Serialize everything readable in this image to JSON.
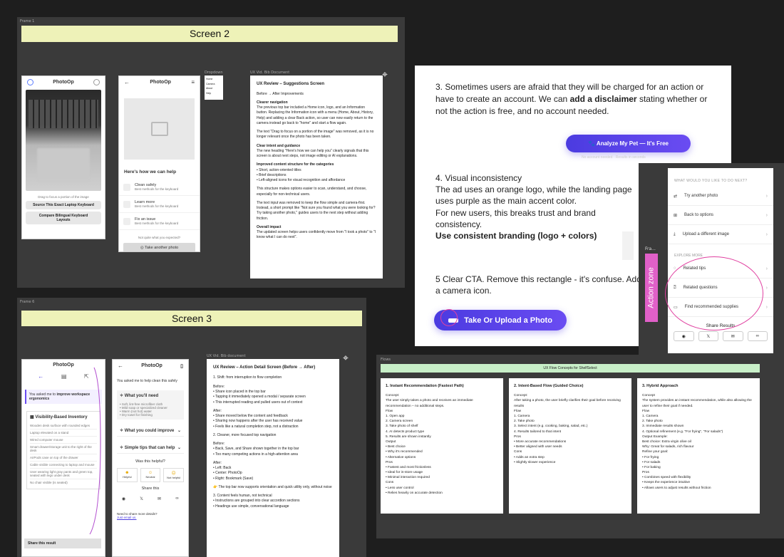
{
  "frames": {
    "frame1_label": "Frame 1",
    "frame2_label": "Frame 6",
    "frame3_label": "Frame"
  },
  "screen2": {
    "title": "Screen 2",
    "phone1": {
      "app": "PhotoOp",
      "hint": "Drag to focus a portion of the image",
      "btn1": "Source This Exact Laptop Keyboard",
      "btn2": "Compare Bilingual Keyboard Layouts"
    },
    "phone2": {
      "app": "PhotoOp",
      "heading": "Here's how we can help",
      "items": [
        {
          "title": "Clean safely",
          "sub": "Best methods for the keyboard"
        },
        {
          "title": "Learn more",
          "sub": "Best methods for the keyboard"
        },
        {
          "title": "Fix an issue",
          "sub": "Best methods for the keyboard"
        }
      ],
      "question": "Not quite what you expected?",
      "cta": "Take another photo"
    },
    "popup": {
      "label": "Dropdown",
      "items": [
        "Home",
        "Camera",
        "About",
        "Help"
      ]
    },
    "doc_label": "UX Vid. Bib Document",
    "doc": {
      "title": "UX Review – Suggestions Screen",
      "subtitle": "Before → After Improvements",
      "s1": "Clearer navigation",
      "p1": "The previous top bar included a Home icon, logo, and an Information button. Replacing the Information icon with a menu (Home, About, History, Help) and adding a clear Back action, so user can now easily return to the camera instead go back to \"home\" and start a flow again.",
      "p2": "The text \"Drag to focus on a portion of the image\" was removed, as it is no longer relevant once the photo has been taken.",
      "s2": "Clear intent and guidance",
      "p3": "The new heading \"Here's how we can help you\" clearly signals that this screen is about next steps, not image editing or AI explanations.",
      "s3": "Improved content structure for the categories",
      "bul1": "• Short, action-oriented titles",
      "bul2": "• Brief descriptions",
      "bul3": "• Left-aligned icons for visual recognition and affordance",
      "p4": "This structure makes options easier to scan, understand, and choose, especially for non-technical users.",
      "p5": "The text input was removed to keep the flow simple and camera-first. Instead, a short prompt like \"Not sure you found what you were looking for? Try taking another photo,\" guides users to the next step without adding friction.",
      "s4": "Overall impact",
      "p6": "The updated screen helps users confidently move from \"I took a photo\" to \"I know what I can do next\"."
    }
  },
  "screen3": {
    "title": "Screen 3",
    "phone1": {
      "app": "PhotoOp",
      "intro_prefix": "You asked me to ",
      "intro_bold": "improve workspace ergonomics",
      "section": "Visibility-Based Inventory",
      "items": [
        "Wooden desk surface with rounded edges",
        "Laptop elevated on a stand",
        "Wired computer mouse",
        "Smart drawer/storage unit to the right of the desk",
        "AirPods case on top of the drawer",
        "Cable visible connecting to laptop and mouse",
        "User wearing light gray pants and green top, seated with legs under desk",
        "No chair visible (is seated)"
      ],
      "share": "Share this result"
    },
    "phone2": {
      "app": "PhotoOp",
      "intro": "You asked me to help clean this safely",
      "need_title": "What you'll need",
      "need_items": [
        "• Soft, lint-free microfiber cloth",
        "• Mild soap or specialized cleaner",
        "• Warm (not hot) water",
        "• Dry towel for finishing"
      ],
      "improve_title": "What you could improve",
      "tips_title": "Simple tips that can help",
      "helpful": "Was this helpful?",
      "fb": [
        "Helpful",
        "Neutral",
        "Not helpful"
      ],
      "share": "Share this",
      "more": "Need to share more details?",
      "link": "Just email us."
    },
    "doc_label": "UX Vid. Bib document",
    "doc": {
      "title": "UX Review – Action Detail Screen (Before → After)",
      "s1": "1. Shift: from interruption to flow completion",
      "before1_h": "Before:",
      "before1": [
        "• Share icon placed in the top bar",
        "• Tapping it immediately opened a modal / separate screen",
        "• This interrupted reading and pulled users out of context"
      ],
      "after1_h": "After:",
      "after1": [
        "• Share moved below the content and feedback",
        "• Sharing now happens after the user has received value",
        "• Feels like a natural completion step, not a distraction"
      ],
      "s2": "2. Cleaner, more focused top navigation",
      "before2_h": "Before:",
      "before2": [
        "• Back, Save, and Share shown together in the top bar",
        "• Too many competing actions in a high-attention area"
      ],
      "after2_h": "After:",
      "after2": [
        "• Left: Back",
        "• Center: PhotoOp",
        "• Right: Bookmark (Save)"
      ],
      "note": "👉 The top bar now supports orientation and quick utility only, without noise",
      "s3": "3. Content feels human, not technical",
      "s3_items": [
        "• Instructions are grouped into clear accordion sections",
        "• Headings use simple, conversational language"
      ]
    }
  },
  "review": {
    "p3_a": "3. Sometimes users are afraid that they will be charged for an action or have to create an account. We can ",
    "p3_bold": "add a disclaimer",
    "p3_b": " stating whether or not the action is free, and no account needed.",
    "cta1": "🐾 Analyze My Pet — It's Free",
    "cta1_sub": "No account needed · Results in seconds",
    "p4_title": "4. Visual inconsistency",
    "p4_a": "The ad uses an orange logo, while the landing page uses purple as the main accent color.",
    "p4_b": "For new users, this breaks trust and brand consistency.",
    "p4_bold": "Use consistent branding (logo + colors)",
    "p5": "5 Clear CTA. Remove this rectangle - it's confuse. Add a camera icon.",
    "cta2": "Take Or Upload a Photo",
    "frame_tag": "Fra...",
    "action_zone": "Action zone"
  },
  "menu_panel": {
    "heading": "WHAT WOULD YOU LIKE TO DO NEXT?",
    "items": [
      "Try another photo",
      "Back to options",
      "Upload a different image"
    ],
    "explore": "EXPLORE MORE",
    "explore_items": [
      "Related tips",
      "Related questions",
      "Find recommended supplies"
    ],
    "share": "Share Results"
  },
  "flows": {
    "frame_label": "Flows",
    "banner": "UX Flow Concepts for ShelfSelect",
    "c1": {
      "title": "1. Instant Recommendation (Fastest Path)",
      "lines": [
        "Concept:",
        "The user simply takes a photo and receives an immediate recommendation – no additional steps.",
        "Flow",
        "1. Open app",
        "2. Camera screen",
        "3. Take photo of shelf",
        "4. AI detects product type",
        "5. Results are shown instantly",
        "Output",
        "• Best choice",
        "• Why it's recommended",
        "• Alternative options",
        "Pros",
        "• Fastest and most frictionless",
        "• Ideal for in-store usage",
        "• Minimal interaction required",
        "Cons",
        "• Less user control",
        "• Relies heavily on accurate detection"
      ]
    },
    "c2": {
      "title": "2. Intent-Based Flow (Guided Choice)",
      "lines": [
        "Concept:",
        "After taking a photo, the user briefly clarifies their goal before receiving results",
        "Flow",
        "1. Camera",
        "2. Take photo",
        "3. Select intent (e.g. cooking, baking, salad, etc.)",
        "4. Results tailored to that intent",
        "Pros",
        "• More accurate recommendations",
        "• Better aligned with user needs",
        "Cons",
        "• Adds an extra step",
        "• Slightly slower experience"
      ]
    },
    "c3": {
      "title": "3. Hybrid Approach",
      "lines": [
        "Concept",
        "The system provides an instant recommendation, while also allowing the user to refine their goal if needed.",
        "Flow",
        "1. Camera",
        "2. Take photo",
        "3. Immediate results shown",
        "4. Optional refinement (e.g. \"For frying\", \"For salads\")",
        "Output Example:",
        "Best choice: Extra virgin olive oil",
        "Why: Great for salads, rich flavour",
        "Refine your goal:",
        "• For frying",
        "• For salads",
        "• For baking",
        "Pros",
        "• Combines speed with flexibility",
        "• Keeps the experience intuitive",
        "• Allows users to adjust results without friction"
      ]
    }
  }
}
